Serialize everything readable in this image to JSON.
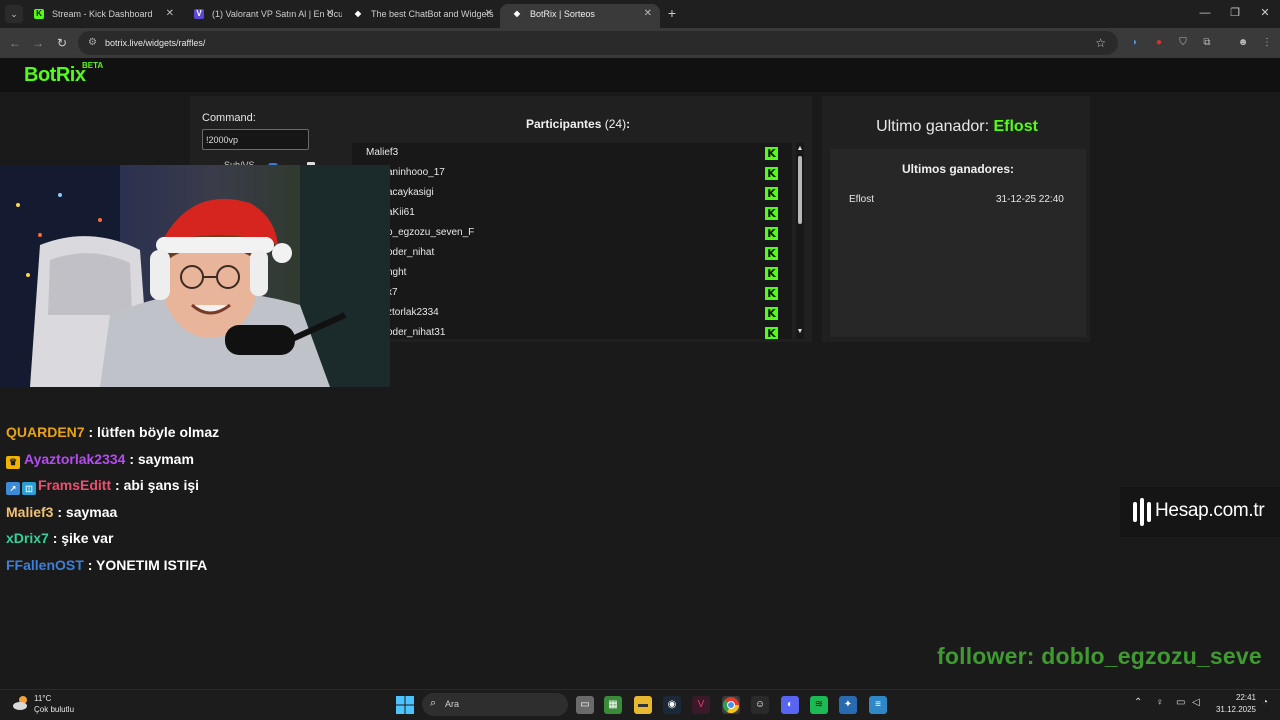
{
  "browser": {
    "tabs": [
      {
        "title": "Stream - Kick Dashboard",
        "favicon": "kick-icon",
        "active": false
      },
      {
        "title": "(1) Valorant VP Satın Al | En Ucu",
        "favicon": "valorant-icon",
        "active": false
      },
      {
        "title": "The best ChatBot and Widgets",
        "favicon": "botrix-icon",
        "active": false
      },
      {
        "title": "BotRix | Sorteos",
        "favicon": "botrix-icon",
        "active": true
      }
    ],
    "url": "botrix.live/widgets/raffles/"
  },
  "site": {
    "logo": "BotRix",
    "logo_badge": "BETA",
    "accent": "#53fc18"
  },
  "raffle": {
    "command_label": "Command:",
    "command_value": "!2000vp",
    "sub_label": "Sub/VS",
    "participants_label": "Participantes",
    "participants_count": "(24)",
    "participants_suffix": ":",
    "participants": [
      "Malief3",
      "aninhooo_17",
      "acaykasigi",
      "aKii61",
      "o_egzozu_seven_F",
      "oder_nihat",
      "nght",
      "x7",
      "ztorlak2334",
      "oder_nihat31"
    ],
    "last_winner_label": "Ultimo ganador:",
    "last_winner": "Eflost",
    "winners_heading": "Ultimos ganadores:",
    "winners": [
      {
        "name": "Eflost",
        "date": "31-12-25 22:40"
      }
    ]
  },
  "chat": [
    {
      "user": "QUARDEN7",
      "message": ": lütfen böyle olmaz",
      "color": "#e8a317",
      "badge": ""
    },
    {
      "user": "Ayaztorlak2334",
      "message": ": saymam",
      "color": "#b44cf0",
      "badge": "crown"
    },
    {
      "user": "FramsEditt",
      "message": ": abi şans işi",
      "color": "#e8506e",
      "badge": "squares"
    },
    {
      "user": "Malief3",
      "message": ": saymaa",
      "color": "#f2c16c",
      "badge": ""
    },
    {
      "user": "xDrix7",
      "message": ": şike var",
      "color": "#35d09a",
      "badge": ""
    },
    {
      "user": "FFallenOST",
      "message": ": YONETIM ISTIFA",
      "color": "#3d7fd9",
      "badge": ""
    }
  ],
  "sponsor": "Hesap.com.tr",
  "follower_text": "follower: doblo_egzozu_seve",
  "taskbar": {
    "weather_temp": "11°C",
    "weather_desc": "Çok bulutlu",
    "search_placeholder": "Ara",
    "time": "22:41",
    "date": "31.12.2025"
  }
}
